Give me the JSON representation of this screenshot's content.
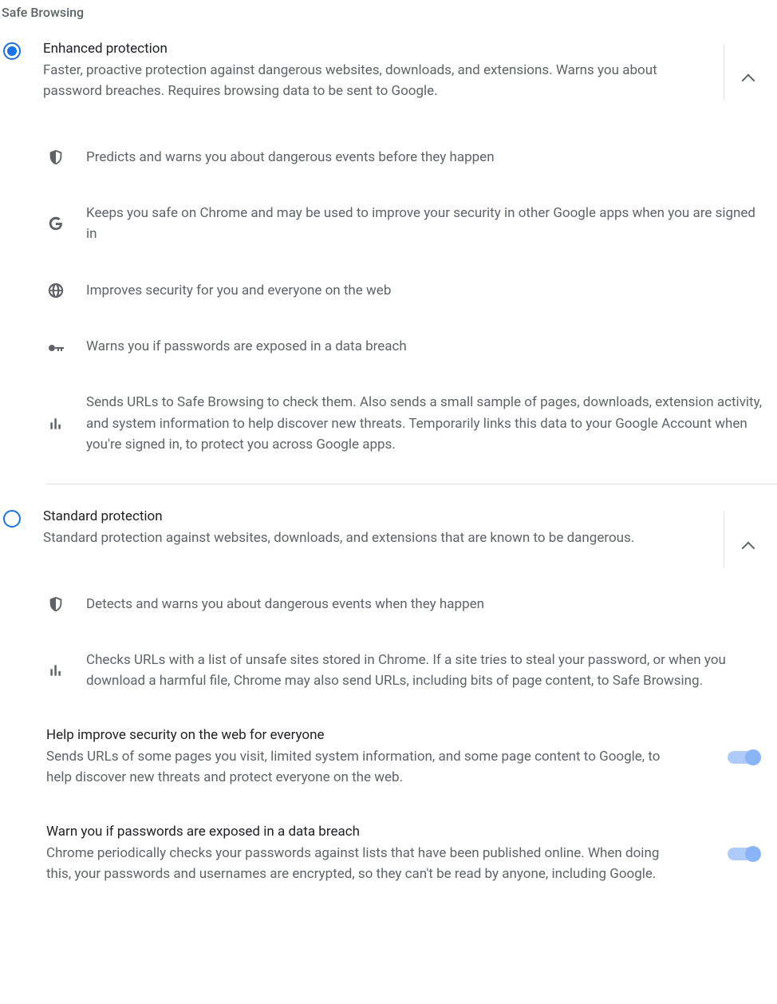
{
  "section_title": "Safe Browsing",
  "enhanced": {
    "title": "Enhanced protection",
    "desc": "Faster, proactive protection against dangerous websites, downloads, and extensions. Warns you about password breaches. Requires browsing data to be sent to Google.",
    "details": [
      "Predicts and warns you about dangerous events before they happen",
      "Keeps you safe on Chrome and may be used to improve your security in other Google apps when you are signed in",
      "Improves security for you and everyone on the web",
      "Warns you if passwords are exposed in a data breach",
      "Sends URLs to Safe Browsing to check them. Also sends a small sample of pages, downloads, extension activity, and system information to help discover new threats. Temporarily links this data to your Google Account when you're signed in, to protect you across Google apps."
    ]
  },
  "standard": {
    "title": "Standard protection",
    "desc": "Standard protection against websites, downloads, and extensions that are known to be dangerous.",
    "details": [
      "Detects and warns you about dangerous events when they happen",
      "Checks URLs with a list of unsafe sites stored in Chrome. If a site tries to steal your password, or when you download a harmful file, Chrome may also send URLs, including bits of page content, to Safe Browsing."
    ]
  },
  "improve": {
    "title": "Help improve security on the web for everyone",
    "desc": "Sends URLs of some pages you visit, limited system information, and some page content to Google, to help discover new threats and protect everyone on the web."
  },
  "breach": {
    "title": "Warn you if passwords are exposed in a data breach",
    "desc": "Chrome periodically checks your passwords against lists that have been published online. When doing this, your passwords and usernames are encrypted, so they can't be read by anyone, including Google."
  }
}
